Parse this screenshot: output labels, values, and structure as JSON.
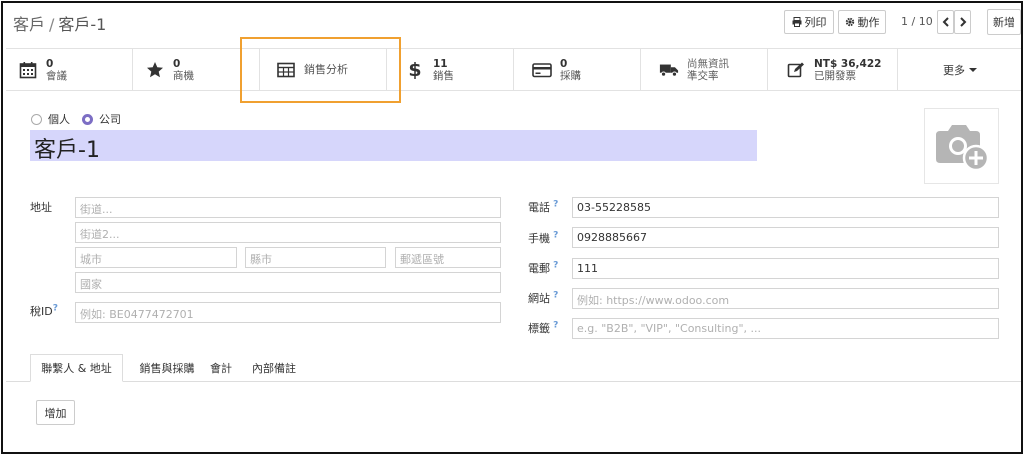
{
  "breadcrumb": {
    "parent": "客戶",
    "separator": "/",
    "current": "客戶-1"
  },
  "toolbar": {
    "print_label": "列印",
    "action_label": "動作",
    "pager": "1 / 10",
    "new_label": "新增"
  },
  "smart_buttons": [
    {
      "value": "0",
      "label": "會議",
      "icon": "calendar-icon"
    },
    {
      "value": "0",
      "label": "商機",
      "icon": "star-icon"
    },
    {
      "value": "",
      "label": "銷售分析",
      "icon": "table-icon"
    },
    {
      "value": "11",
      "label": "銷售",
      "icon": "dollar-icon"
    },
    {
      "value": "0",
      "label": "採購",
      "icon": "credit-card-icon"
    },
    {
      "value": "尚無資訊",
      "label": "準交率",
      "icon": "truck-icon"
    },
    {
      "value": "NT$ 36,422",
      "label": "已開發票",
      "icon": "edit-icon"
    },
    {
      "value": "",
      "label": "更多",
      "icon": "caret-down-icon"
    }
  ],
  "form": {
    "company_type": {
      "individual": "個人",
      "company": "公司",
      "selected": "company"
    },
    "name": "客戶-1",
    "address_label": "地址",
    "street_placeholder": "街道...",
    "street2_placeholder": "街道2...",
    "city_placeholder": "城市",
    "state_placeholder": "縣市",
    "zip_placeholder": "郵遞區號",
    "country_placeholder": "國家",
    "tax_label": "稅ID",
    "tax_placeholder": "例如: BE0477472701",
    "phone_label": "電話",
    "phone_value": "03-55228585",
    "mobile_label": "手機",
    "mobile_value": "0928885667",
    "email_label": "電郵",
    "email_value": "111",
    "website_label": "網站",
    "website_placeholder": "例如: https://www.odoo.com",
    "tags_label": "標籤",
    "tags_placeholder": "e.g. \"B2B\", \"VIP\", \"Consulting\", ..."
  },
  "tabs": [
    "聯繫人 & 地址",
    "銷售與採購",
    "會計",
    "內部備註"
  ],
  "add_label": "增加",
  "colors": {
    "accent": "#7c6ec4",
    "name_bg": "#d6d6fb",
    "highlight": "#f0a030"
  }
}
